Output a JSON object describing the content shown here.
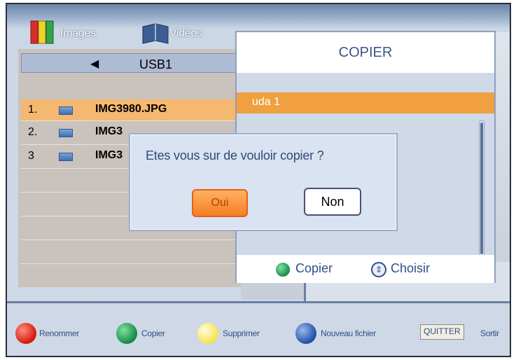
{
  "tabs": [
    {
      "label": "Images",
      "icon": "images-bars-icon"
    },
    {
      "label": "Vidéos",
      "icon": "video-book-icon"
    }
  ],
  "file_panel": {
    "device": "USB1",
    "files": [
      {
        "num": "1.",
        "name": "IMG3980.JPG",
        "selected": true
      },
      {
        "num": "2.",
        "name": "IMG3"
      },
      {
        "num": "3",
        "name": "IMG3"
      }
    ]
  },
  "copy_dialog": {
    "title": "COPIER",
    "destination": "uda 1",
    "footer": {
      "copy_label": "Copier",
      "choose_label": "Choisir"
    }
  },
  "confirm_dialog": {
    "question": "Etes vous sur de vouloir copier ?",
    "yes_label": "Oui",
    "no_label": "Non"
  },
  "bottom_hints": {
    "red": "Renommer",
    "green": "Copier",
    "yellow": "Supprimer",
    "blue": "Nouveau fichier",
    "quit_key": "QUITTER",
    "quit_label": "Sortir"
  },
  "colors": {
    "selection": "#f5b870",
    "destination_highlight": "#f0a040",
    "accent_text": "#2d4f86"
  }
}
